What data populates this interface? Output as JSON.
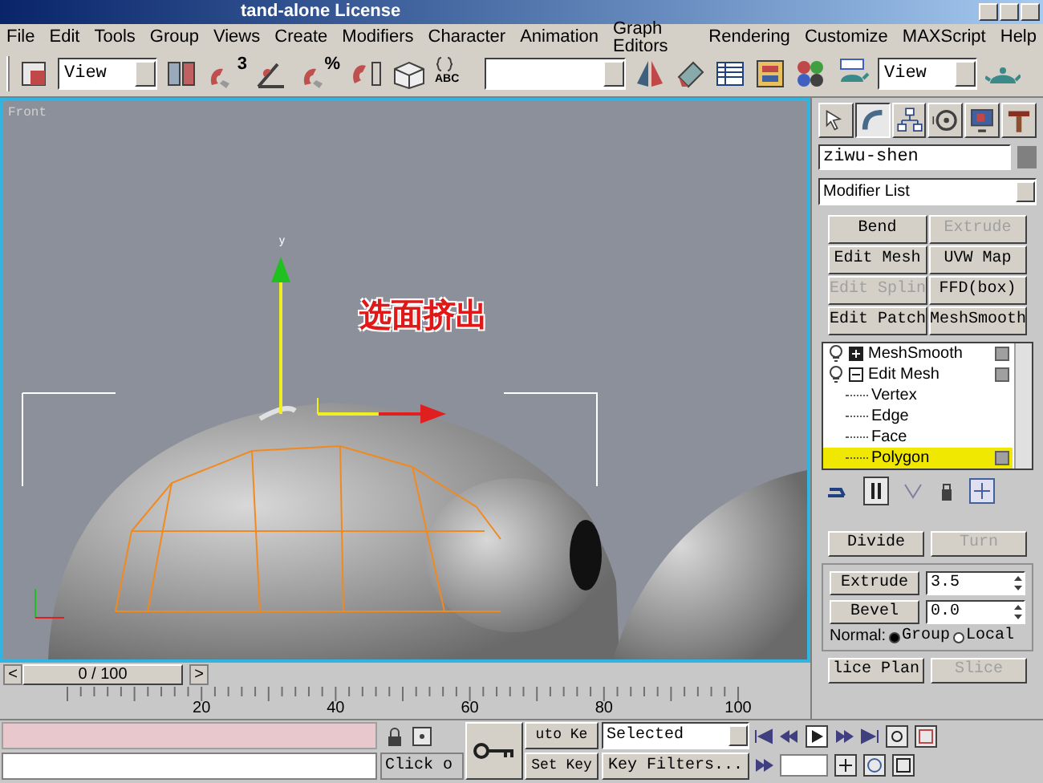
{
  "window": {
    "title": "tand-alone License"
  },
  "menu": [
    "File",
    "Edit",
    "Tools",
    "Group",
    "Views",
    "Create",
    "Modifiers",
    "Character",
    "Animation",
    "Graph Editors",
    "Rendering",
    "Customize",
    "MAXScript",
    "Help"
  ],
  "toolbar": {
    "reference_coord": "View",
    "snap_label": "3",
    "percent_snap_label": "%",
    "named_edit_label": "ABC",
    "render_view": "View"
  },
  "viewport": {
    "label": "Front",
    "gizmo_label": "y",
    "caption": "选面挤出"
  },
  "time_slider": {
    "prev": "<",
    "position": "0 / 100",
    "next": ">"
  },
  "ruler": {
    "labels": [
      "20",
      "40",
      "60",
      "80",
      "100"
    ]
  },
  "command_panel": {
    "tabs": [
      {
        "kind": "create",
        "selected": false
      },
      {
        "kind": "modify",
        "selected": true
      },
      {
        "kind": "hierarchy",
        "selected": false
      },
      {
        "kind": "motion",
        "selected": false
      },
      {
        "kind": "display",
        "selected": false
      },
      {
        "kind": "utilities",
        "selected": false
      }
    ],
    "object_name": "ziwu-shen",
    "modifier_list": "Modifier List",
    "modifier_buttons": [
      {
        "label": "Bend",
        "disabled": false
      },
      {
        "label": "Extrude",
        "disabled": true
      },
      {
        "label": "Edit Mesh",
        "disabled": false
      },
      {
        "label": "UVW Map",
        "disabled": false
      },
      {
        "label": "Edit Splin",
        "disabled": true
      },
      {
        "label": "FFD(box)",
        "disabled": false
      },
      {
        "label": "Edit Patch",
        "disabled": false
      },
      {
        "label": "MeshSmooth",
        "disabled": false
      }
    ],
    "stack": [
      {
        "label": "MeshSmooth",
        "expanded": false,
        "selected": false
      },
      {
        "label": "Edit Mesh",
        "expanded": true,
        "selected": false,
        "children": [
          {
            "label": "Vertex",
            "selected": false
          },
          {
            "label": "Edge",
            "selected": false
          },
          {
            "label": "Face",
            "selected": false
          },
          {
            "label": "Polygon",
            "selected": true
          }
        ]
      }
    ],
    "rollout": {
      "divide": {
        "label": "Divide",
        "disabled": false
      },
      "turn": {
        "label": "Turn",
        "disabled": true
      },
      "extrude": {
        "label": "Extrude",
        "value": "3.5"
      },
      "bevel": {
        "label": "Bevel",
        "value": "0.0"
      },
      "normal": {
        "label": "Normal:",
        "options": [
          {
            "label": "Group",
            "selected": true
          },
          {
            "label": "Local",
            "selected": false
          }
        ]
      },
      "slice_plane": {
        "label": "lice Plan",
        "disabled": false
      },
      "slice": {
        "label": "Slice",
        "disabled": true
      }
    }
  },
  "status_bar": {
    "click_hint": "Click o",
    "auto_key": "uto Ke",
    "set_key": "Set Key",
    "key_mode": "Selected",
    "key_filters": "Key Filters..."
  }
}
